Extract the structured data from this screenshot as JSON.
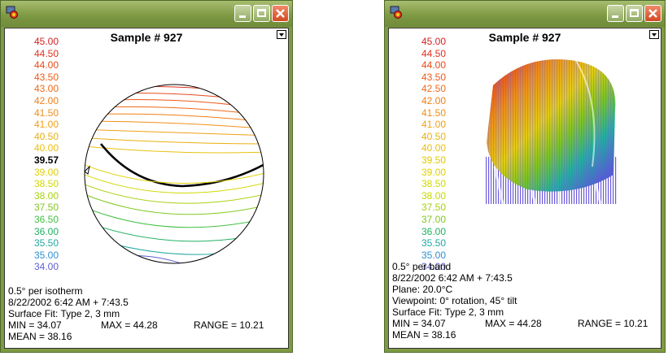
{
  "windows": [
    {
      "title": "Sample # 927",
      "scale": [
        {
          "label": "45.00",
          "color": "#d42020"
        },
        {
          "label": "44.50",
          "color": "#e03020"
        },
        {
          "label": "44.00",
          "color": "#e84a1a"
        },
        {
          "label": "43.50",
          "color": "#ec5a18"
        },
        {
          "label": "43.00",
          "color": "#f06a18"
        },
        {
          "label": "42.00",
          "color": "#f07e18"
        },
        {
          "label": "41.50",
          "color": "#f09018"
        },
        {
          "label": "41.00",
          "color": "#f0a018"
        },
        {
          "label": "40.50",
          "color": "#e8b010"
        },
        {
          "label": "40.00",
          "color": "#e8c010"
        },
        {
          "label": "39.57",
          "color": "#000000",
          "bold": true
        },
        {
          "label": "39.00",
          "color": "#e0d000"
        },
        {
          "label": "38.50",
          "color": "#d0d800"
        },
        {
          "label": "38.00",
          "color": "#a8d010"
        },
        {
          "label": "37.50",
          "color": "#80c820"
        },
        {
          "label": "36.50",
          "color": "#40c040"
        },
        {
          "label": "36.00",
          "color": "#20b060"
        },
        {
          "label": "35.50",
          "color": "#20a8a0"
        },
        {
          "label": "35.00",
          "color": "#3090d0"
        },
        {
          "label": "34.00",
          "color": "#6060d0"
        }
      ],
      "info": {
        "line1": "0.5° per isotherm",
        "line2": "8/22/2002 6:42 AM + 7:43.5",
        "line3": "Surface Fit: Type 2, 3 mm",
        "min": "MIN = 34.07",
        "max": "MAX = 44.28",
        "range": "RANGE = 10.21",
        "mean": "MEAN = 38.16"
      }
    },
    {
      "title": "Sample # 927",
      "scale": [
        {
          "label": "45.00",
          "color": "#d42020"
        },
        {
          "label": "44.50",
          "color": "#e03020"
        },
        {
          "label": "44.00",
          "color": "#e84a1a"
        },
        {
          "label": "43.50",
          "color": "#ec5a18"
        },
        {
          "label": "42.50",
          "color": "#f06a18"
        },
        {
          "label": "42.00",
          "color": "#f07e18"
        },
        {
          "label": "41.50",
          "color": "#f09018"
        },
        {
          "label": "41.00",
          "color": "#f0a018"
        },
        {
          "label": "40.50",
          "color": "#e8b010"
        },
        {
          "label": "40.00",
          "color": "#e8c010"
        },
        {
          "label": "39.50",
          "color": "#e0c800"
        },
        {
          "label": "39.00",
          "color": "#e0d000"
        },
        {
          "label": "38.50",
          "color": "#d0d800"
        },
        {
          "label": "38.00",
          "color": "#c8d800"
        },
        {
          "label": "37.50",
          "color": "#a8d010"
        },
        {
          "label": "37.00",
          "color": "#80c820"
        },
        {
          "label": "36.00",
          "color": "#20b060"
        },
        {
          "label": "35.50",
          "color": "#20a8a0"
        },
        {
          "label": "35.00",
          "color": "#3090d0"
        },
        {
          "label": "34.00",
          "color": "#6060d0"
        }
      ],
      "info": {
        "line1": "0.5° per band",
        "line2": "8/22/2002 6:42 AM + 7:43.5",
        "line3": "Plane: 20.0°C",
        "line4": "Viewpoint: 0° rotation, 45° tilt",
        "line5": "Surface Fit: Type 2, 3 mm",
        "min": "MIN = 34.07",
        "max": "MAX = 44.28",
        "range": "RANGE = 10.21",
        "mean": "MEAN = 38.16"
      }
    }
  ]
}
